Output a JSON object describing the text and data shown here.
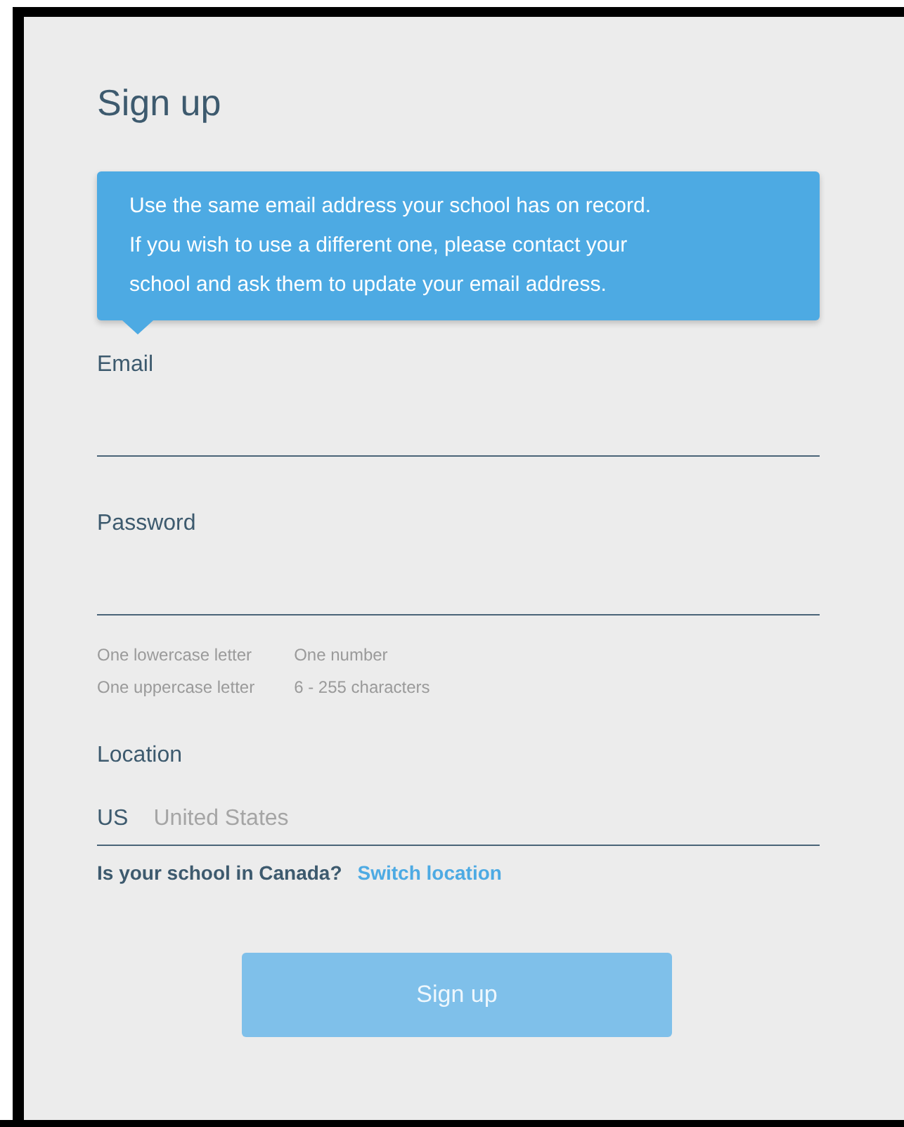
{
  "title": "Sign up",
  "tooltip": "Use the same email address your school has on record. If you wish to use a different one, please contact your school and ask them to update your email address.",
  "fields": [
    {
      "label": "Email"
    },
    {
      "label": "Password"
    }
  ],
  "password_rules": [
    [
      "One lowercase letter",
      "One uppercase letter"
    ],
    [
      "One number",
      "6 - 255 characters"
    ]
  ],
  "location": {
    "label": "Location",
    "prefix": "US",
    "placeholder": "United States"
  },
  "canada": {
    "question": "Is your school in Canada?",
    "link": "Switch location"
  },
  "submit": {
    "label": "Sign up",
    "disabled": true
  }
}
